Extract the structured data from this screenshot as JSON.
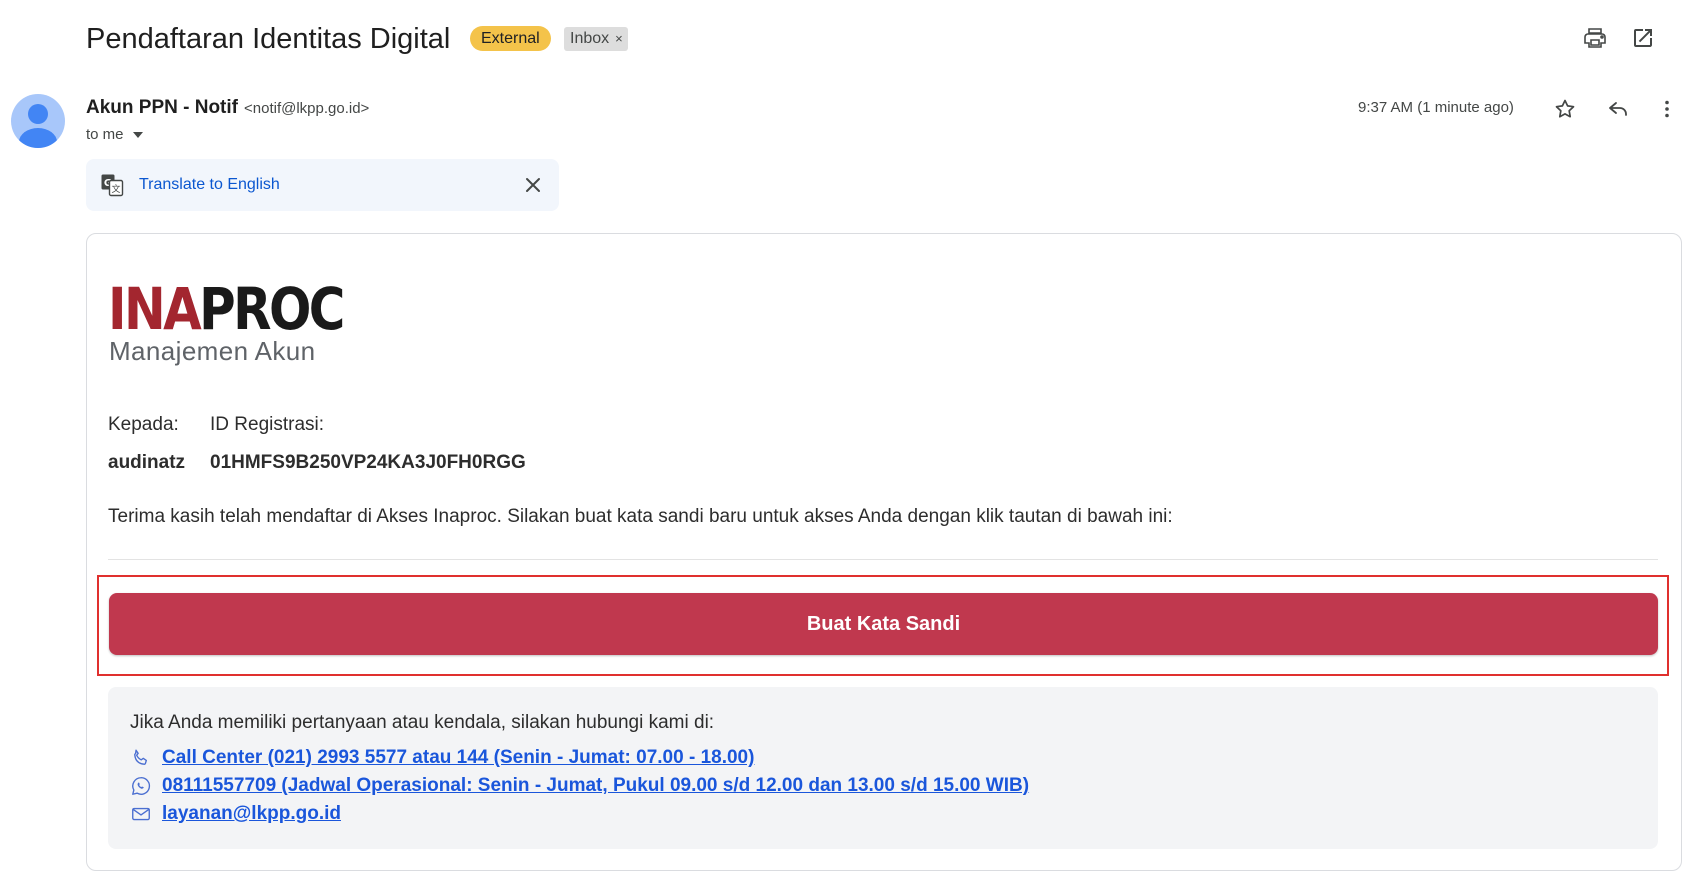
{
  "header": {
    "subject": "Pendaftaran Identitas Digital",
    "badges": {
      "external": "External",
      "inbox": "Inbox",
      "inbox_remove": "×"
    }
  },
  "sender": {
    "name": "Akun PPN - Notif",
    "email": "<notif@lkpp.go.id>",
    "recipient": "to me",
    "timestamp": "9:37 AM (1 minute ago)"
  },
  "translate": {
    "label": "Translate to English"
  },
  "email": {
    "logo": {
      "part1": "INA",
      "part2": "PROC",
      "subtitle": "Manajemen Akun"
    },
    "fields": {
      "to_label": "Kepada:",
      "to_value": "audinatz",
      "id_label": "ID Registrasi:",
      "id_value": "01HMFS9B250VP24KA3J0FH0RGG"
    },
    "message": "Terima kasih telah mendaftar di Akses Inaproc. Silakan buat kata sandi baru untuk akses Anda dengan klik tautan di bawah ini:",
    "cta_label": "Buat Kata Sandi",
    "contact": {
      "intro": "Jika Anda memiliki pertanyaan atau kendala, silakan hubungi kami di:",
      "phone": "Call Center (021) 2993 5577 atau 144 (Senin - Jumat: 07.00 - 18.00)",
      "whatsapp": "08111557709 (Jadwal Operasional: Senin - Jumat, Pukul 09.00 s/d 12.00 dan 13.00 s/d 15.00 WIB)",
      "email": "layanan@lkpp.go.id"
    }
  },
  "colors": {
    "badge_external": "#f4c34a",
    "badge_inbox": "#dddddd",
    "brand_red": "#a3262f",
    "cta": "#c0384e",
    "highlight": "#e0302e",
    "link": "#1a56db",
    "translate_link": "#0b57d0"
  },
  "icons": {
    "print": "print-icon",
    "open_in_new": "open-in-new-icon",
    "star": "star-icon",
    "reply": "reply-icon",
    "more": "more-vert-icon",
    "translate": "translate-icon",
    "close": "close-icon",
    "phone": "phone-icon",
    "whatsapp": "whatsapp-icon",
    "mail": "mail-icon"
  }
}
